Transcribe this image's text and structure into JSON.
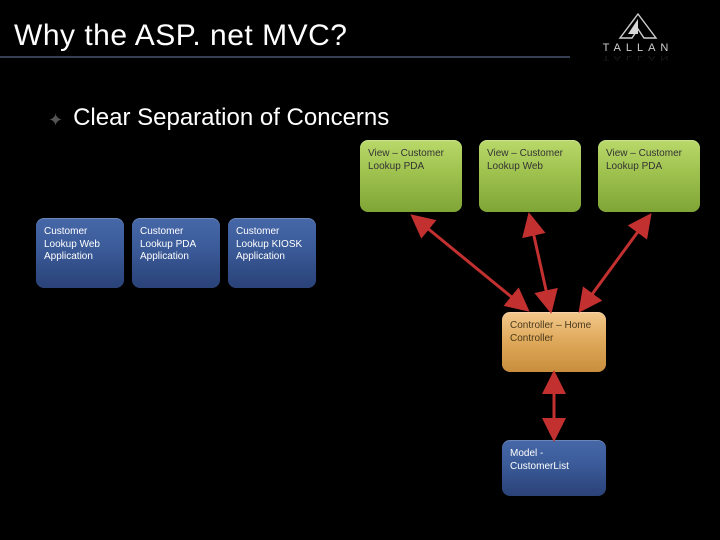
{
  "title": "Why the ASP. net MVC?",
  "logo": {
    "name": "TALLAN"
  },
  "bullet": {
    "text": "Clear Separation of Concerns"
  },
  "left_boxes": [
    "Customer Lookup Web Application",
    "Customer Lookup PDA Application",
    "Customer Lookup KIOSK Application"
  ],
  "diagram": {
    "views": [
      "View – Customer Lookup PDA",
      "View – Customer Lookup Web",
      "View – Customer Lookup PDA"
    ],
    "controller": "Controller – Home Controller",
    "model": "Model - CustomerList"
  }
}
